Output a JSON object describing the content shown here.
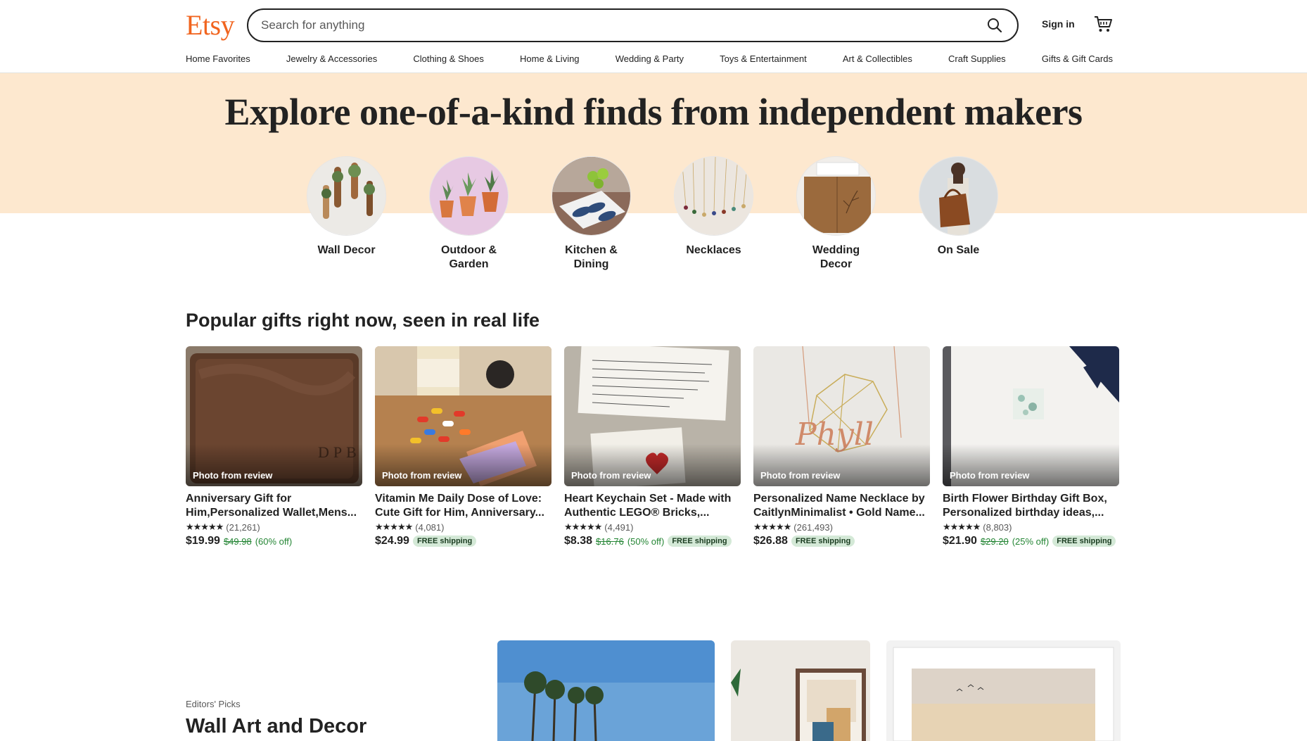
{
  "header": {
    "logo": "Etsy",
    "search_placeholder": "Search for anything",
    "sign_in": "Sign in",
    "brand_color": "#f1641e"
  },
  "nav": {
    "items": [
      "Home Favorites",
      "Jewelry & Accessories",
      "Clothing & Shoes",
      "Home & Living",
      "Wedding & Party",
      "Toys & Entertainment",
      "Art & Collectibles",
      "Craft Supplies",
      "Gifts & Gift Cards"
    ]
  },
  "hero": {
    "title": "Explore one-of-a-kind finds from independent makers",
    "background": "#fde8cf",
    "categories": [
      {
        "label_line1": "Wall Decor",
        "label_line2": ""
      },
      {
        "label_line1": "Outdoor &",
        "label_line2": "Garden"
      },
      {
        "label_line1": "Kitchen &",
        "label_line2": "Dining"
      },
      {
        "label_line1": "Necklaces",
        "label_line2": ""
      },
      {
        "label_line1": "Wedding",
        "label_line2": "Decor"
      },
      {
        "label_line1": "On Sale",
        "label_line2": ""
      }
    ]
  },
  "popular": {
    "title": "Popular gifts right now, seen in real life",
    "photo_badge": "Photo from review",
    "stars": "★★★★★",
    "products": [
      {
        "title": "Anniversary Gift for Him,Personalized Wallet,Mens...",
        "reviews": "(21,261)",
        "price": "$19.99",
        "original_price": "$49.98",
        "discount": "(60% off)",
        "free_shipping": ""
      },
      {
        "title": "Vitamin Me Daily Dose of Love: Cute Gift for Him, Anniversary...",
        "reviews": "(4,081)",
        "price": "$24.99",
        "original_price": "",
        "discount": "",
        "free_shipping": "FREE shipping"
      },
      {
        "title": "Heart Keychain Set - Made with Authentic LEGO® Bricks,...",
        "reviews": "(4,491)",
        "price": "$8.38",
        "original_price": "$16.76",
        "discount": "(50% off)",
        "free_shipping": "FREE shipping"
      },
      {
        "title": "Personalized Name Necklace by CaitlynMinimalist • Gold Name...",
        "reviews": "(261,493)",
        "price": "$26.88",
        "original_price": "",
        "discount": "",
        "free_shipping": "FREE shipping"
      },
      {
        "title": "Birth Flower Birthday Gift Box, Personalized birthday ideas,...",
        "reviews": "(8,803)",
        "price": "$21.90",
        "original_price": "$29.20",
        "discount": "(25% off)",
        "free_shipping": "FREE shipping"
      }
    ]
  },
  "editors": {
    "kicker": "Editors' Picks",
    "title": "Wall Art and Decor"
  }
}
